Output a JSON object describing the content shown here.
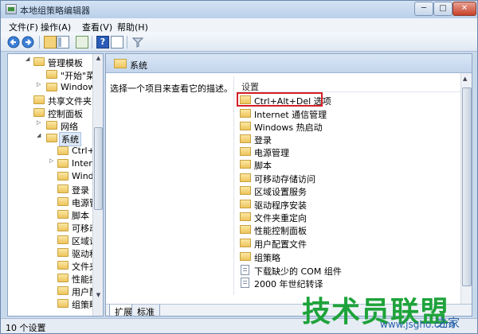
{
  "window": {
    "title": "本地组策略编辑器",
    "min_glyph": "─",
    "max_glyph": "□",
    "close_glyph": "✕"
  },
  "menu": [
    "文件(F)",
    "操作(A)",
    "查看(V)",
    "帮助(H)"
  ],
  "toolbar": {
    "icons": [
      "back-arrow-icon",
      "forward-arrow-icon",
      "up-folder-icon",
      "show-hide-tree-icon",
      "export-list-icon",
      "help-icon",
      "properties-icon",
      "filter-icon"
    ],
    "help_glyph": "?"
  },
  "tree": {
    "items": [
      {
        "label": "管理模板",
        "toggle": "◢"
      },
      {
        "label": "\"开始\"菜",
        "toggle": ""
      },
      {
        "label": "Windows",
        "toggle": "▷"
      },
      {
        "label": "共享文件夹",
        "toggle": ""
      },
      {
        "label": "控制面板",
        "toggle": "▷"
      },
      {
        "label": "网络",
        "toggle": "▷"
      },
      {
        "label": "系统",
        "toggle": "◢"
      },
      {
        "label": "Ctrl+Alt",
        "toggle": ""
      },
      {
        "label": "Interne",
        "toggle": "▷"
      },
      {
        "label": "Windo",
        "toggle": ""
      },
      {
        "label": "登录",
        "toggle": ""
      },
      {
        "label": "电源管",
        "toggle": ""
      },
      {
        "label": "脚本",
        "toggle": ""
      },
      {
        "label": "可移动",
        "toggle": ""
      },
      {
        "label": "区域设",
        "toggle": ""
      },
      {
        "label": "驱动程",
        "toggle": ""
      },
      {
        "label": "文件夹",
        "toggle": ""
      },
      {
        "label": "性能控",
        "toggle": ""
      },
      {
        "label": "用户配",
        "toggle": ""
      },
      {
        "label": "组策略",
        "toggle": ""
      }
    ]
  },
  "right": {
    "header_title": "系统",
    "description": "选择一个项目来查看它的描述。",
    "column_header": "设置",
    "settings": [
      {
        "label": "Ctrl+Alt+Del 选项",
        "icon": "folder"
      },
      {
        "label": "Internet 通信管理",
        "icon": "folder"
      },
      {
        "label": "Windows 热启动",
        "icon": "folder"
      },
      {
        "label": "登录",
        "icon": "folder"
      },
      {
        "label": "电源管理",
        "icon": "folder"
      },
      {
        "label": "脚本",
        "icon": "folder"
      },
      {
        "label": "可移动存储访问",
        "icon": "folder"
      },
      {
        "label": "区域设置服务",
        "icon": "folder"
      },
      {
        "label": "驱动程序安装",
        "icon": "folder"
      },
      {
        "label": "文件夹重定向",
        "icon": "folder"
      },
      {
        "label": "性能控制面板",
        "icon": "folder"
      },
      {
        "label": "用户配置文件",
        "icon": "folder"
      },
      {
        "label": "组策略",
        "icon": "folder"
      },
      {
        "label": "下载缺少的 COM 组件",
        "icon": "document"
      },
      {
        "label": "2000 年世纪转译",
        "icon": "document"
      }
    ],
    "highlight_color": "#d41f26",
    "tabs": [
      "扩展",
      "标准"
    ]
  },
  "status": {
    "text": "10 个设置"
  },
  "watermark": {
    "big": "技术员联盟",
    "small": "www.jsgho.com",
    "tail": "之家"
  }
}
